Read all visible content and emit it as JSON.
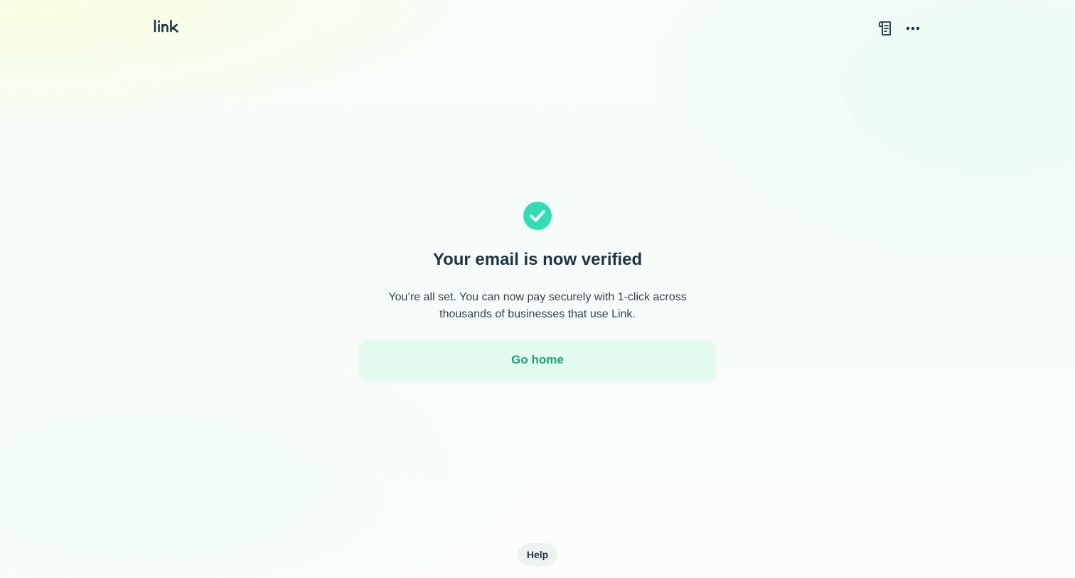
{
  "header": {
    "logo_text": "link",
    "logo_icon": "link-logo",
    "receipt_icon": "receipt-icon",
    "more_icon": "more-horizontal-icon"
  },
  "main": {
    "status_icon": "check-circle-icon",
    "title": "Your email is now verified",
    "description": "You’re all set. You can now pay securely with 1-click across thousands of businesses that use Link.",
    "primary_button_label": "Go home"
  },
  "footer": {
    "help_label": "Help"
  },
  "colors": {
    "accent_green": "#33ddb3",
    "button_bg": "#e2fbee",
    "button_text": "#1d9f79",
    "text_dark": "#1d3441"
  }
}
